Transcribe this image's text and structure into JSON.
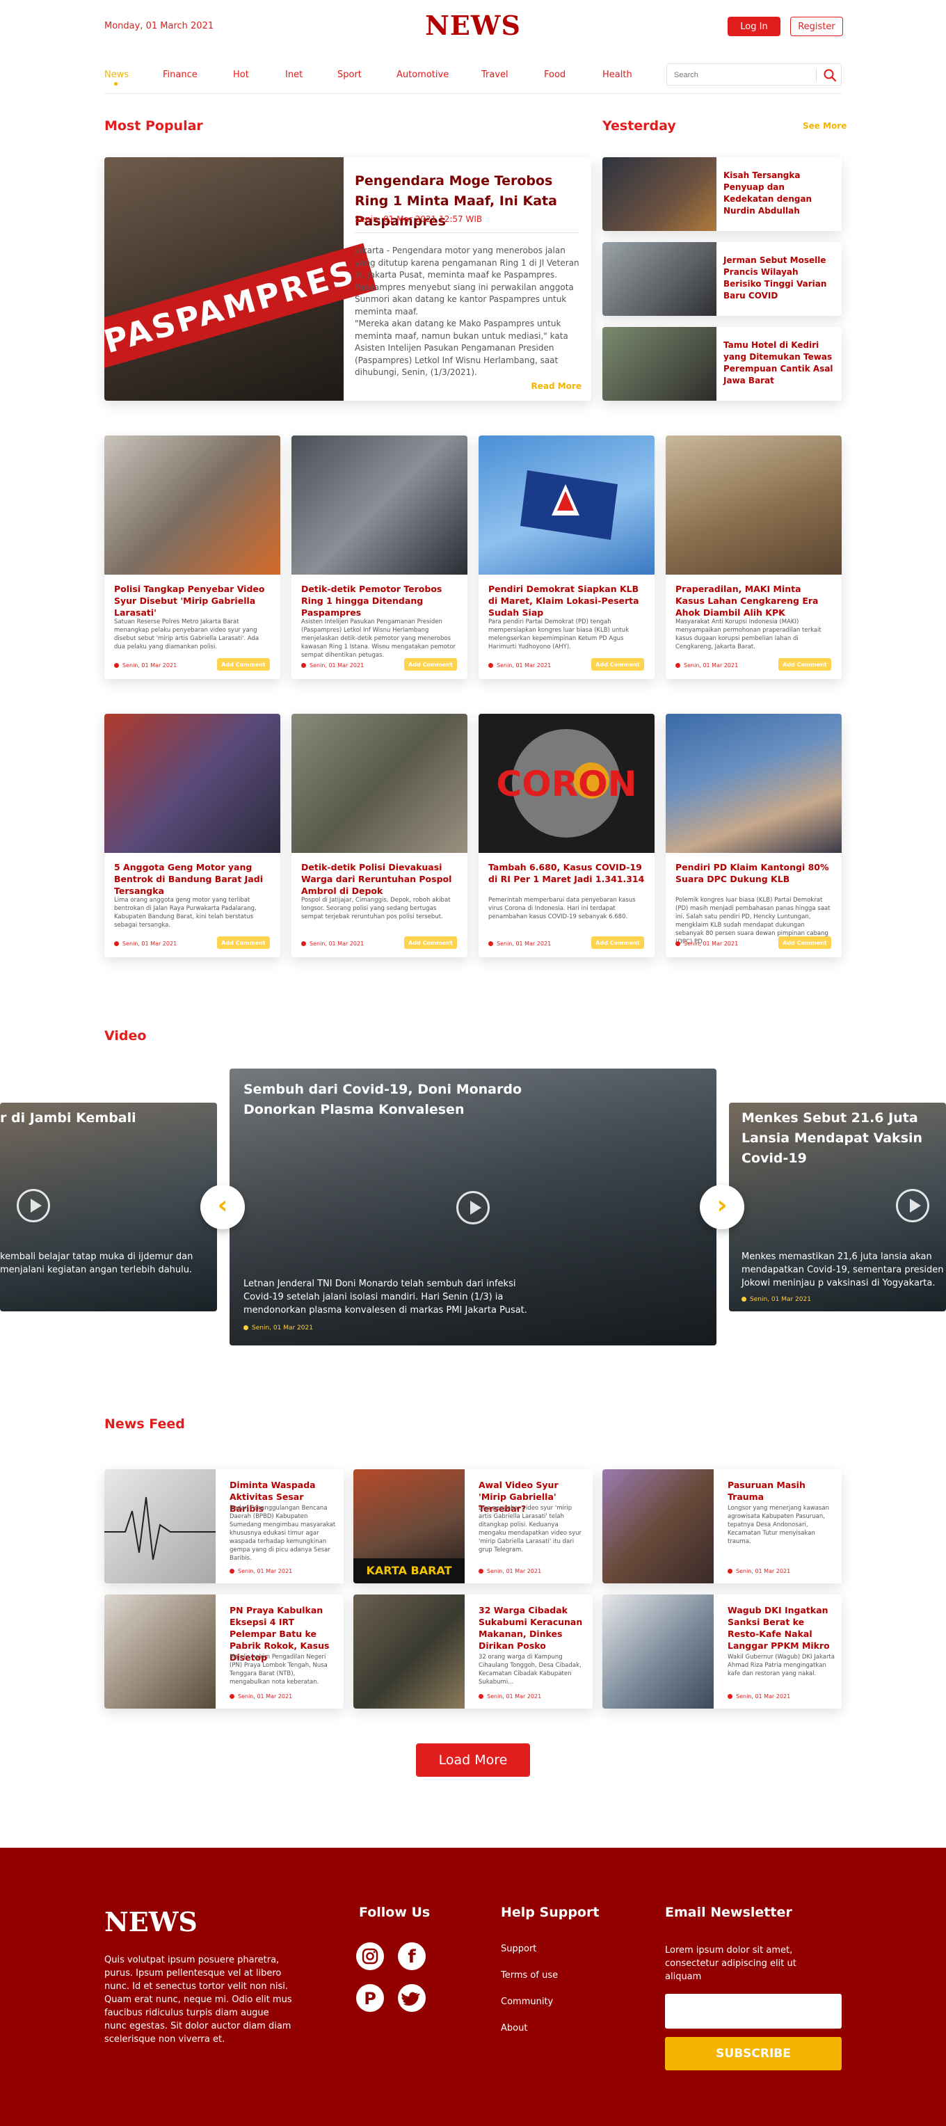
{
  "header": {
    "date": "Monday, 01 March 2021",
    "logo": "NEWS",
    "login_label": "Log In",
    "register_label": "Register"
  },
  "nav": {
    "items": [
      "News",
      "Finance",
      "Hot",
      "Inet",
      "Sport",
      "Automotive",
      "Travel",
      "Food",
      "Health"
    ],
    "active": "News"
  },
  "search": {
    "placeholder": "Search",
    "icon": "search-icon"
  },
  "most_popular": {
    "title": "Most Popular",
    "feature": {
      "image_text": "PASPAMPRES",
      "title": "Pengendara Moge Terobos Ring 1 Minta Maaf, Ini Kata Paspampres",
      "date": "Senin, 01 Mar 2021 12:57 WIB",
      "body": "Jakarta - Pengendara motor yang menerobos jalan yang ditutup karena pengamanan Ring 1 di Jl Veteran III, Jakarta Pusat, meminta maaf ke Paspampres. Paspampres menyebut siang ini perwakilan anggota Sunmori akan datang ke kantor Paspampres untuk meminta maaf.\n\"Mereka akan datang ke Mako Paspampres untuk meminta maaf, namun bukan untuk mediasi,\" kata Asisten Intelijen Pasukan Pengamanan Presiden (Paspampres) Letkol Inf Wisnu Herlambang, saat dihubungi, Senin, (1/3/2021).",
      "read_more": "Read More"
    }
  },
  "yesterday": {
    "title": "Yesterday",
    "see_more": "See More",
    "items": [
      {
        "title": "Kisah Tersangka Penyuap dan Kedekatan dengan Nurdin Abdullah"
      },
      {
        "title": "Jerman Sebut Moselle Prancis Wilayah Berisiko Tinggi Varian Baru COVID"
      },
      {
        "title": "Tamu Hotel di Kediri yang Ditemukan Tewas Perempuan Cantik Asal Jawa Barat"
      }
    ]
  },
  "grid": {
    "comment_label": "Add Comment",
    "cards": [
      {
        "title": "Polisi Tangkap Penyebar Video Syur Disebut 'Mirip Gabriella Larasati'",
        "desc": "Satuan Reserse Polres Metro Jakarta Barat menangkap pelaku penyebaran video syur yang disebut sebut 'mirip artis Gabriella Larasati'. Ada dua pelaku yang diamankan polisi.",
        "date": "Senin, 01 Mar 2021"
      },
      {
        "title": "Detik-detik Pemotor Terobos Ring 1 hingga Ditendang Paspampres",
        "desc": "Asisten Intelijen Pasukan Pengamanan Presiden (Paspampres) Letkol Inf Wisnu Herlambang menjelaskan detik-detik pemotor yang menerobos kawasan Ring 1 Istana. Wisnu mengatakan pemotor sempat dihentikan petugas.",
        "date": "Senin, 01 Mar 2021"
      },
      {
        "title": "Pendiri Demokrat Siapkan KLB di Maret, Klaim Lokasi-Peserta Sudah Siap",
        "desc": "Para pendiri Partai Demokrat (PD) tengah mempersiapkan kongres luar biasa (KLB) untuk melengserkan kepemimpinan Ketum PD Agus Harimurti Yudhoyono (AHY).",
        "date": "Senin, 01 Mar 2021"
      },
      {
        "title": "Praperadilan, MAKI Minta Kasus Lahan Cengkareng Era Ahok Diambil Alih KPK",
        "desc": "Masyarakat Anti Korupsi Indonesia (MAKI) menyampaikan permohonan praperadilan terkait kasus dugaan korupsi pembelian lahan di Cengkareng, Jakarta Barat.",
        "date": "Senin, 01 Mar 2021"
      },
      {
        "title": "5 Anggota Geng Motor yang Bentrok di Bandung Barat Jadi Tersangka",
        "desc": "Lima orang anggota geng motor yang terlibat bentrokan di Jalan Raya Purwakarta Padalarang, Kabupaten Bandung Barat, kini telah berstatus sebagai tersangka.",
        "date": "Senin, 01 Mar 2021"
      },
      {
        "title": "Detik-detik Polisi Dievakuasi Warga dari Reruntuhan Pospol Ambrol di Depok",
        "desc": "Pospol di Jatijajar, Cimanggis, Depok, roboh akibat longsor. Seorang polisi yang sedang bertugas sempat terjebak reruntuhan pos polisi tersebut.",
        "date": "Senin, 01 Mar 2021"
      },
      {
        "title": "Tambah 6.680, Kasus COVID-19 di RI Per 1 Maret Jadi 1.341.314",
        "desc": "Pemerintah memperbarui data penyebaran kasus virus Corona di Indonesia. Hari ini terdapat penambahan kasus COVID-19 sebanyak 6.680.",
        "date": "Senin, 01 Mar 2021",
        "image_text": "CORON"
      },
      {
        "title": "Pendiri PD Klaim Kantongi 80% Suara DPC Dukung KLB",
        "desc": "Polemik kongres luar biasa (KLB) Partai Demokrat (PD) masih menjadi pembahasan panas hingga saat ini. Salah satu pendiri PD, Hencky Luntungan, mengklaim KLB sudah mendapat dukungan sebanyak 80 persen suara dewan pimpinan cabang (DPC) PD.",
        "date": "Senin, 01 Mar 2021"
      }
    ]
  },
  "video": {
    "title": "Video",
    "main": {
      "title": "Sembuh dari Covid-19, Doni Monardo Donorkan Plasma Konvalesen",
      "desc": "Letnan Jenderal TNI Doni Monardo telah sembuh dari infeksi Covid-19 setelah jalani isolasi mandiri. Hari Senin (1/3) ia mendonorkan plasma konvalesen di markas PMI Jakarta Pusat.",
      "date": "Senin, 01 Mar 2021"
    },
    "left": {
      "title": "r di Jambi Kembali",
      "desc": "kembali belajar tatap muka di ijdemur dan menjalani kegiatan angan terlebih dahulu."
    },
    "right": {
      "title": "Menkes Sebut 21.6 Juta Lansia Mendapat Vaksin Covid-19",
      "desc": "Menkes memastikan 21,6 juta lansia akan mendapatkan Covid-19, sementara presiden Jokowi meninjau p vaksinasi di Yogyakarta.",
      "date": "Senin, 01 Mar 2021"
    },
    "prev_icon": "chevron-left-icon",
    "next_icon": "chevron-right-icon"
  },
  "feed": {
    "title": "News Feed",
    "items": [
      {
        "title": "Diminta Waspada Aktivitas Sesar Baribis",
        "desc": "Badan Penanggulangan Bencana Daerah (BPBD) Kabupaten Sumedang mengimbau masyarakat khususnya edukasi timur agar waspada terhadap kemungkinan gempa yang di picu adanya Sesar Baribis.",
        "date": "Senin, 01 Mar 2021"
      },
      {
        "title": "Awal Video Syur 'Mirip Gabriella' Tersebar?",
        "desc": "Dua penyebar video syur 'mirip artis Gabriella Larasati' telah ditangkap polisi. Keduanya mengaku mendapatkan video syur 'mirip Gabriella Larasati' itu dari grup Telegram.",
        "date": "Senin, 01 Mar 2021",
        "image_text": "KARTA BARAT"
      },
      {
        "title": "Pasuruan Masih Trauma",
        "desc": "Longsor yang menerjang kawasan agrowisata Kabupaten Pasuruan, tepatnya Desa Andonosari, Kecamatan Tutur menyisakan trauma.",
        "date": "Senin, 01 Mar 2021"
      },
      {
        "title": "PN Praya Kabulkan Eksepsi 4 IRT Pelempar Batu ke Pabrik Rokok, Kasus Disetop",
        "desc": "Majelis hakim Pengadilan Negeri (PN) Praya Lombok Tengah, Nusa Tenggara Barat (NTB), mengabulkan nota keberatan.",
        "date": "Senin, 01 Mar 2021"
      },
      {
        "title": "32 Warga Cibadak Sukabumi Keracunan Makanan, Dinkes Dirikan Posko",
        "desc": "32 orang warga di Kampung Cihaulang Tonggoh, Desa Cibadak, Kecamatan Cibadak Kabupaten Sukabumi...",
        "date": "Senin, 01 Mar 2021"
      },
      {
        "title": "Wagub DKI Ingatkan Sanksi Berat ke Resto-Kafe Nakal Langgar PPKM Mikro",
        "desc": "Wakil Gubernur (Wagub) DKI Jakarta Ahmad Riza Patria mengingatkan kafe dan restoran yang nakal.",
        "date": "Senin, 01 Mar 2021"
      }
    ],
    "load_more": "Load More"
  },
  "footer": {
    "logo": "NEWS",
    "about": "Quis volutpat ipsum posuere pharetra, purus. Ipsum pellentesque vel at libero nunc. Id et senectus tortor velit non nisi. Quam erat nunc, neque mi. Odio elit mus faucibus ridiculus turpis diam augue nunc egestas. Sit dolor auctor diam diam scelerisque non viverra et.",
    "follow_title": "Follow Us",
    "social": [
      "instagram-icon",
      "facebook-icon",
      "pinterest-icon",
      "twitter-icon"
    ],
    "help_title": "Help Support",
    "help_links": [
      "Support",
      "Terms of use",
      "Community",
      "About"
    ],
    "newsletter_title": "Email Newsletter",
    "newsletter_text": "Lorem ipsum dolor sit amet, consectetur adipiscing elit ut aliquam",
    "subscribe_label": "SUBSCRIBE"
  }
}
